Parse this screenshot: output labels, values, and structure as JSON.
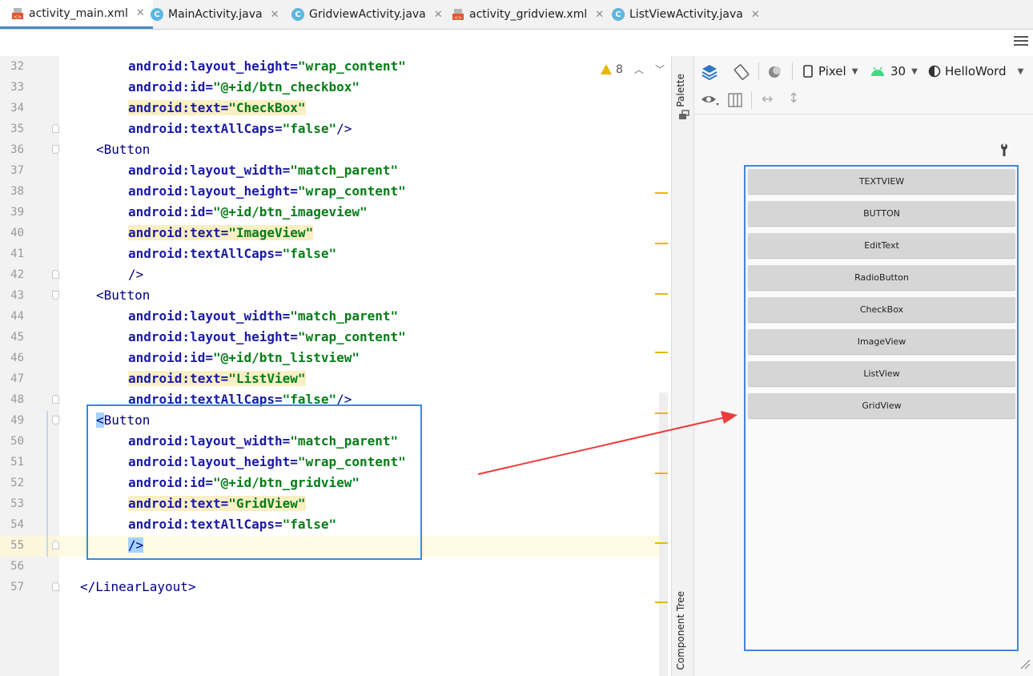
{
  "tabs": [
    {
      "label": "activity_main.xml",
      "type": "xml",
      "active": true
    },
    {
      "label": "MainActivity.java",
      "type": "java",
      "active": false
    },
    {
      "label": "GridviewActivity.java",
      "type": "java",
      "active": false
    },
    {
      "label": "activity_gridview.xml",
      "type": "xml",
      "active": false
    },
    {
      "label": "ListViewActivity.java",
      "type": "java",
      "active": false
    }
  ],
  "editor": {
    "warning_count": "8",
    "lines": [
      {
        "n": "32",
        "indent": 2,
        "segs": [
          {
            "t": "android:layout_height=",
            "c": "attr"
          },
          {
            "t": "\"wrap_content\"",
            "c": "str"
          }
        ]
      },
      {
        "n": "33",
        "indent": 2,
        "segs": [
          {
            "t": "android:id=",
            "c": "attr"
          },
          {
            "t": "\"@+id/btn_checkbox\"",
            "c": "str"
          }
        ]
      },
      {
        "n": "34",
        "indent": 2,
        "hl": true,
        "segs": [
          {
            "t": "android:text=",
            "c": "attr"
          },
          {
            "t": "\"CheckBox\"",
            "c": "str"
          }
        ]
      },
      {
        "n": "35",
        "indent": 2,
        "fold": "up",
        "segs": [
          {
            "t": "android:textAllCaps=",
            "c": "attr"
          },
          {
            "t": "\"false\"",
            "c": "str"
          },
          {
            "t": "/>",
            "c": "tag"
          }
        ]
      },
      {
        "n": "36",
        "indent": 1,
        "fold": "down",
        "segs": [
          {
            "t": "<Button",
            "c": "tag"
          }
        ]
      },
      {
        "n": "37",
        "indent": 2,
        "segs": [
          {
            "t": "android:layout_width=",
            "c": "attr"
          },
          {
            "t": "\"match_parent\"",
            "c": "str"
          }
        ]
      },
      {
        "n": "38",
        "indent": 2,
        "segs": [
          {
            "t": "android:layout_height=",
            "c": "attr"
          },
          {
            "t": "\"wrap_content\"",
            "c": "str"
          }
        ]
      },
      {
        "n": "39",
        "indent": 2,
        "segs": [
          {
            "t": "android:id=",
            "c": "attr"
          },
          {
            "t": "\"@+id/btn_imageview\"",
            "c": "str"
          }
        ]
      },
      {
        "n": "40",
        "indent": 2,
        "hl": true,
        "segs": [
          {
            "t": "android:text=",
            "c": "attr"
          },
          {
            "t": "\"ImageView\"",
            "c": "str"
          }
        ]
      },
      {
        "n": "41",
        "indent": 2,
        "segs": [
          {
            "t": "android:textAllCaps=",
            "c": "attr"
          },
          {
            "t": "\"false\"",
            "c": "str"
          }
        ]
      },
      {
        "n": "42",
        "indent": 2,
        "fold": "up",
        "segs": [
          {
            "t": "/>",
            "c": "tag"
          }
        ]
      },
      {
        "n": "43",
        "indent": 1,
        "fold": "down",
        "segs": [
          {
            "t": "<Button",
            "c": "tag"
          }
        ]
      },
      {
        "n": "44",
        "indent": 2,
        "segs": [
          {
            "t": "android:layout_width=",
            "c": "attr"
          },
          {
            "t": "\"match_parent\"",
            "c": "str"
          }
        ]
      },
      {
        "n": "45",
        "indent": 2,
        "segs": [
          {
            "t": "android:layout_height=",
            "c": "attr"
          },
          {
            "t": "\"wrap_content\"",
            "c": "str"
          }
        ]
      },
      {
        "n": "46",
        "indent": 2,
        "segs": [
          {
            "t": "android:id=",
            "c": "attr"
          },
          {
            "t": "\"@+id/btn_listview\"",
            "c": "str"
          }
        ]
      },
      {
        "n": "47",
        "indent": 2,
        "hl": true,
        "segs": [
          {
            "t": "android:text=",
            "c": "attr"
          },
          {
            "t": "\"ListView\"",
            "c": "str"
          }
        ]
      },
      {
        "n": "48",
        "indent": 2,
        "fold": "up",
        "segs": [
          {
            "t": "android:textAllCaps=",
            "c": "attr"
          },
          {
            "t": "\"false\"",
            "c": "str"
          },
          {
            "t": "/>",
            "c": "tag"
          }
        ]
      },
      {
        "n": "49",
        "indent": 1,
        "fold": "down",
        "segs": [
          {
            "t": "<",
            "c": "sel"
          },
          {
            "t": "Button",
            "c": "tag"
          }
        ]
      },
      {
        "n": "50",
        "indent": 2,
        "segs": [
          {
            "t": "android:layout_width=",
            "c": "attr"
          },
          {
            "t": "\"match_parent\"",
            "c": "str"
          }
        ]
      },
      {
        "n": "51",
        "indent": 2,
        "segs": [
          {
            "t": "android:layout_height=",
            "c": "attr"
          },
          {
            "t": "\"wrap_content\"",
            "c": "str"
          }
        ]
      },
      {
        "n": "52",
        "indent": 2,
        "segs": [
          {
            "t": "android:id=",
            "c": "attr"
          },
          {
            "t": "\"@+id/btn_gridview\"",
            "c": "str"
          }
        ]
      },
      {
        "n": "53",
        "indent": 2,
        "hl": true,
        "segs": [
          {
            "t": "android:text=",
            "c": "attr"
          },
          {
            "t": "\"GridView\"",
            "c": "str"
          }
        ]
      },
      {
        "n": "54",
        "indent": 2,
        "segs": [
          {
            "t": "android:textAllCaps=",
            "c": "attr"
          },
          {
            "t": "\"false\"",
            "c": "str"
          }
        ]
      },
      {
        "n": "55",
        "indent": 2,
        "fold": "up",
        "current": true,
        "segs": [
          {
            "t": "/>",
            "c": "sel"
          }
        ]
      },
      {
        "n": "56",
        "indent": 0,
        "segs": []
      },
      {
        "n": "57",
        "indent": 0,
        "fold": "up",
        "segs": [
          {
            "t": "</LinearLayout>",
            "c": "tag"
          }
        ]
      }
    ]
  },
  "side_tabs": {
    "palette": "Palette",
    "component_tree": "Component Tree"
  },
  "design_toolbar": {
    "device": "Pixel",
    "api": "30",
    "theme": "HelloWord"
  },
  "preview_buttons": [
    "TEXTVIEW",
    "BUTTON",
    "EditText",
    "RadioButton",
    "CheckBox",
    "ImageView",
    "ListView",
    "GridView"
  ],
  "colors": {
    "accent": "#4a88c7",
    "highlight_box": "#3a8ad8",
    "arrow": "#ee3b3b",
    "warning": "#e6b800"
  }
}
